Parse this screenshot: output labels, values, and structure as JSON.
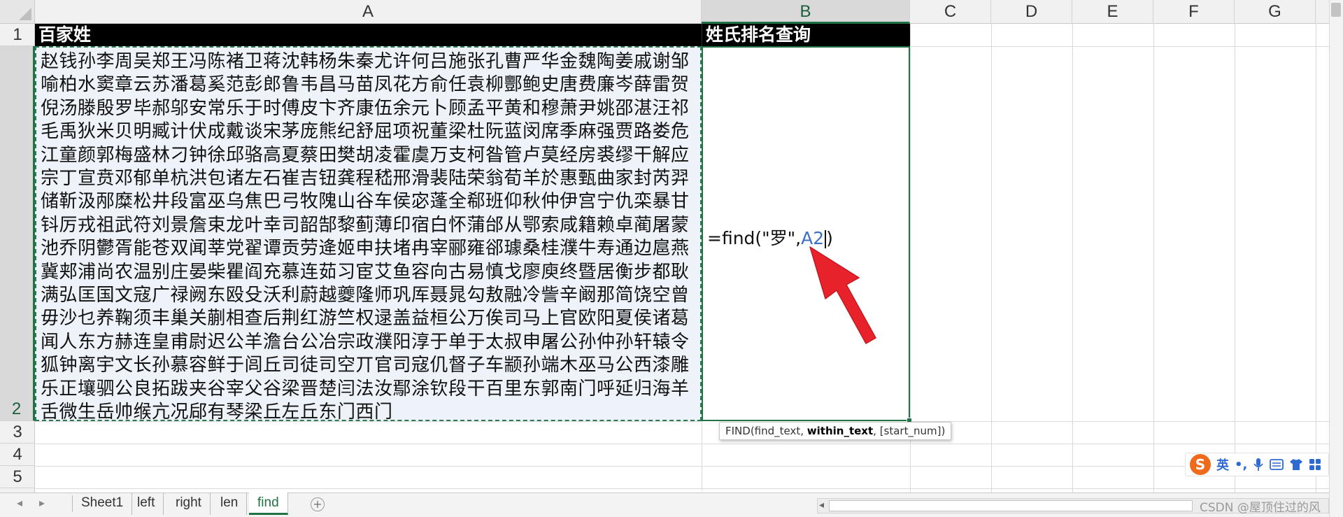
{
  "columns": [
    "A",
    "B",
    "C",
    "D",
    "E",
    "F",
    "G"
  ],
  "rows": [
    "1",
    "2",
    "3",
    "4",
    "5"
  ],
  "cells": {
    "A1": "百家姓",
    "B1": "姓氏排名查询",
    "A2": "赵钱孙李周吴郑王冯陈褚卫蒋沈韩杨朱秦尤许何吕施张孔曹严华金魏陶姜戚谢邹喻柏水窦章云苏潘葛奚范彭郎鲁韦昌马苗凤花方俞任袁柳酆鲍史唐费廉岑薛雷贺倪汤滕殷罗毕郝邬安常乐于时傅皮卞齐康伍余元卜顾孟平黄和穆萧尹姚邵湛汪祁毛禹狄米贝明臧计伏成戴谈宋茅庞熊纪舒屈项祝董梁杜阮蓝闵席季麻强贾路娄危江童颜郭梅盛林刁钟徐邱骆高夏蔡田樊胡凌霍虞万支柯昝管卢莫经房裘缪干解应宗丁宣贲邓郁单杭洪包诸左石崔吉钮龚程嵇邢滑裴陆荣翁荀羊於惠甄曲家封芮羿储靳汲邴糜松井段富巫乌焦巴弓牧隗山谷车侯宓蓬全郗班仰秋仲伊宫宁仇栾暴甘钭厉戎祖武符刘景詹束龙叶幸司韶郜黎蓟薄印宿白怀蒲邰从鄂索咸籍赖卓蔺屠蒙池乔阴鬱胥能苍双闻莘党翟谭贡劳逄姬申扶堵冉宰郦雍郤璩桑桂濮牛寿通边扈燕冀郏浦尚农温别庄晏柴瞿阎充慕连茹习宦艾鱼容向古易慎戈廖庾终暨居衡步都耿满弘匡国文寇广禄阙东殴殳沃利蔚越夔隆师巩厍聂晁勾敖融冷訾辛阚那简饶空曾毋沙乜养鞠须丰巢关蒯相查后荆红游竺权逯盖益桓公万俟司马上官欧阳夏侯诸葛闻人东方赫连皇甫尉迟公羊澹台公冶宗政濮阳淳于单于太叔申屠公孙仲孙轩辕令狐钟离宇文长孙慕容鲜于闾丘司徒司空丌官司寇仉督子车颛孙端木巫马公西漆雕乐正壤驷公良拓跋夹谷宰父谷梁晋楚闫法汝鄢涂钦段干百里东郭南门呼延归海羊舌微生岳帅缑亢况郈有琴梁丘左丘东门西门",
    "B2_formula_prefix": "=find(\"罗\",",
    "B2_formula_ref": "A2",
    "B2_formula_suffix": ")"
  },
  "tooltip": {
    "func": "FIND(find_text, ",
    "bold_arg": "within_text",
    "rest": ", [start_num])"
  },
  "sheets": [
    "Sheet1",
    "left",
    "right",
    "len",
    "find"
  ],
  "active_sheet": "find",
  "ime": {
    "logo": "S",
    "lang": "英",
    "punct": "•,"
  },
  "watermark": "CSDN @屋顶住过的风",
  "colors": {
    "accent": "#217346",
    "arrow": "#e8222b",
    "ref": "#3d6fc7"
  }
}
